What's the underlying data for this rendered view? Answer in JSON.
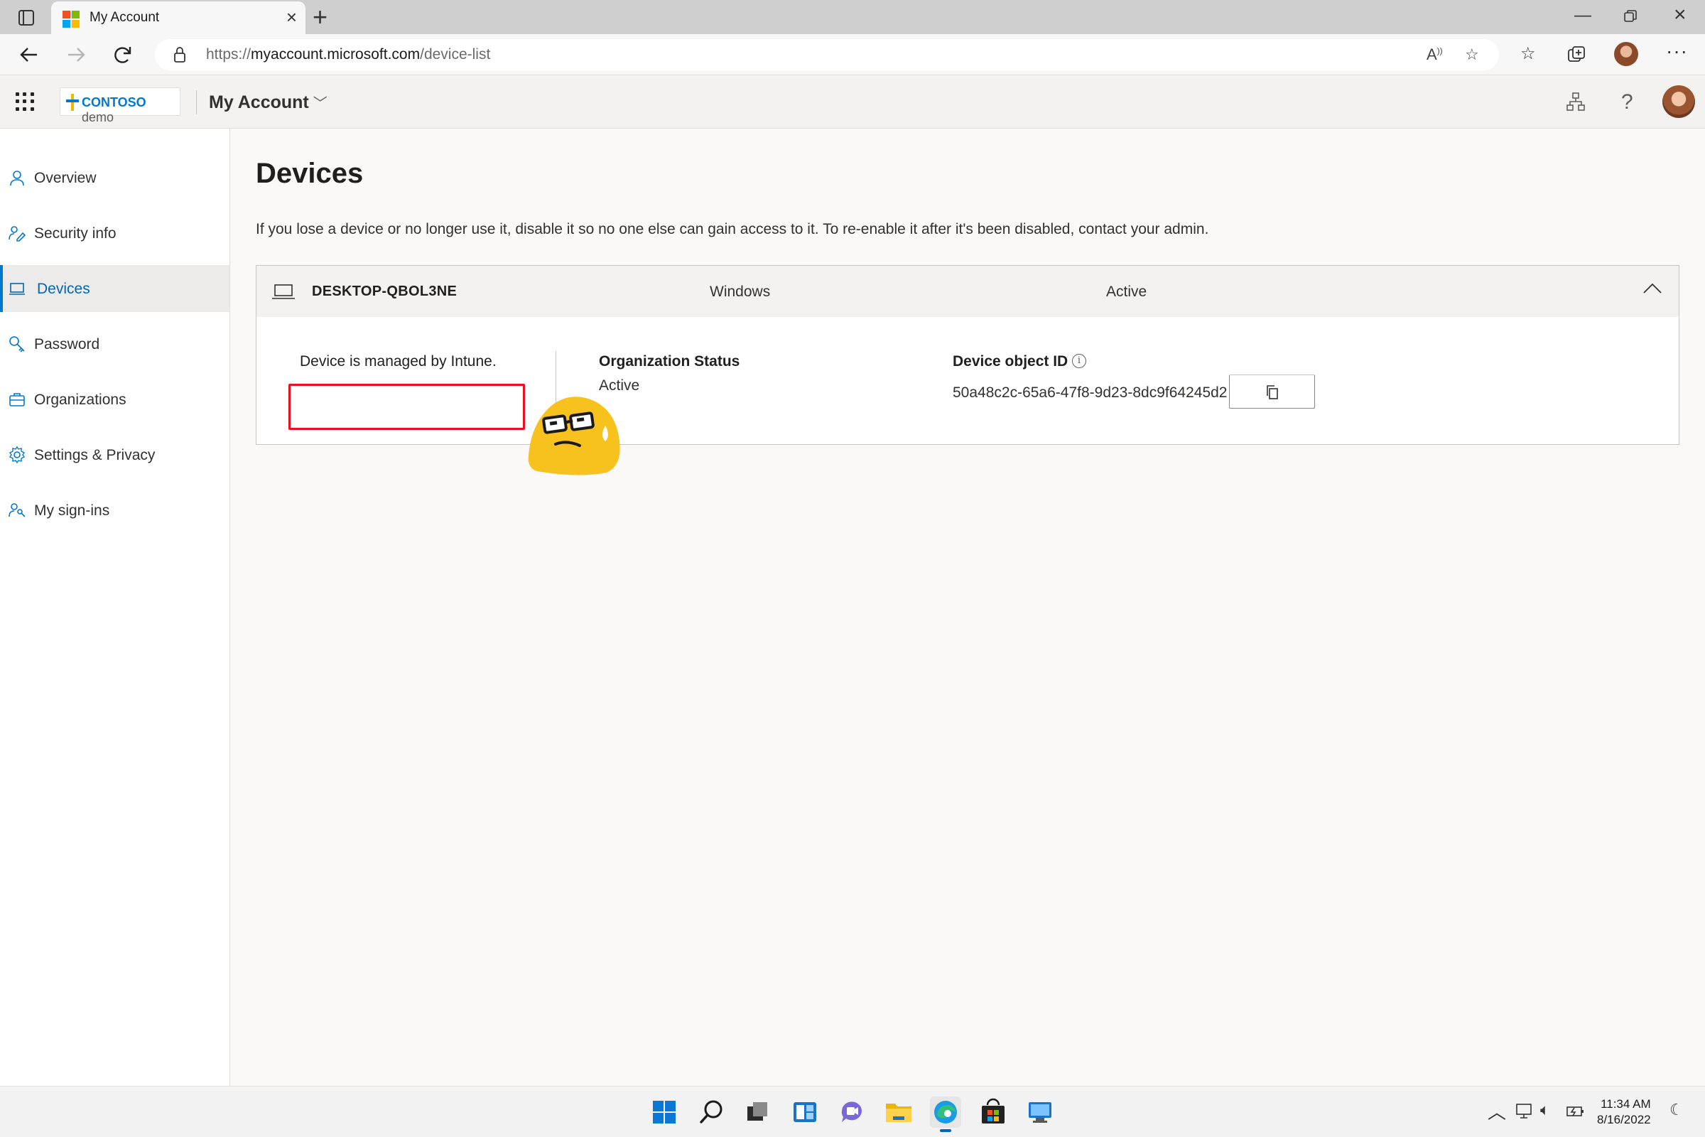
{
  "browser": {
    "tab_title": "My Account",
    "url_prefix": "https://",
    "url_host": "myaccount.microsoft.com",
    "url_path": "/device-list"
  },
  "header": {
    "brand_name": "CONTOSO",
    "brand_suffix": "demo",
    "app_name": "My Account"
  },
  "sidebar": {
    "items": [
      {
        "label": "Overview",
        "icon": "person-icon"
      },
      {
        "label": "Security info",
        "icon": "security-info-icon"
      },
      {
        "label": "Devices",
        "icon": "laptop-icon",
        "active": true
      },
      {
        "label": "Password",
        "icon": "key-icon"
      },
      {
        "label": "Organizations",
        "icon": "briefcase-icon"
      },
      {
        "label": "Settings & Privacy",
        "icon": "gear-icon"
      },
      {
        "label": "My sign-ins",
        "icon": "sign-ins-icon"
      }
    ]
  },
  "main": {
    "title": "Devices",
    "description": "If you lose a device or no longer use it, disable it so no one else can gain access to it. To re-enable it after it's been disabled, contact your admin.",
    "device": {
      "name": "DESKTOP-QBOL3NE",
      "os": "Windows",
      "status": "Active",
      "managed_text": "Device is managed by Intune.",
      "org_status_label": "Organization Status",
      "org_status_value": "Active",
      "object_id_label": "Device object ID",
      "object_id_value": "50a48c2c-65a6-47f8-9d23-8dc9f64245d2"
    }
  },
  "taskbar": {
    "time": "11:34 AM",
    "date": "8/16/2022"
  },
  "colors": {
    "accent": "#0078d4",
    "highlight_box": "#e81123"
  }
}
